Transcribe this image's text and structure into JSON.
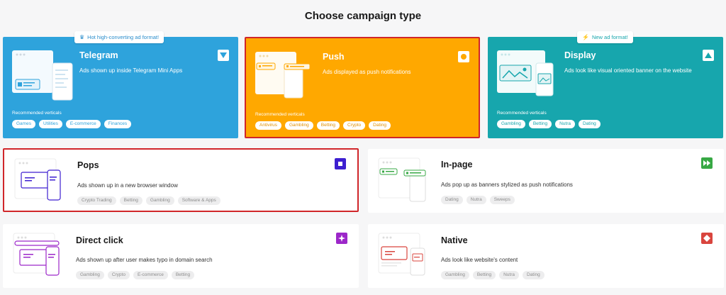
{
  "page": {
    "title": "Choose campaign type"
  },
  "colors": {
    "telegram": "#2ea3dc",
    "push": "#ffa800",
    "display": "#17a6ad",
    "selected_border": "#d0262a",
    "pops": "#3d1fd0",
    "inpage": "#37a844",
    "directclick": "#9c27c9",
    "native": "#d9453e"
  },
  "cards": {
    "telegram": {
      "name": "Telegram",
      "desc": "Ads shown up inside Telegram Mini Apps",
      "badge": "Hot high-converting ad format!",
      "badge_icon": "crown-icon",
      "rec_label": "Recommended verticals",
      "tags": [
        "Games",
        "Utilities",
        "E-commerce",
        "Finances"
      ],
      "icon": "triangle-down-icon"
    },
    "push": {
      "name": "Push",
      "desc": "Ads displayed as push notifications",
      "rec_label": "Recommended verticals",
      "tags": [
        "Antivirus",
        "Gambling",
        "Betting",
        "Crypto",
        "Dating"
      ],
      "icon": "circle-icon",
      "selected": true
    },
    "display": {
      "name": "Display",
      "desc": "Ads look like visual oriented banner on the website",
      "badge": "New ad format!",
      "badge_icon": "lightning-icon",
      "rec_label": "Recommended verticals",
      "tags": [
        "Gambling",
        "Betting",
        "Nutra",
        "Dating"
      ],
      "icon": "triangle-up-icon"
    },
    "pops": {
      "name": "Pops",
      "desc": "Ads shown up in a new browser window",
      "tags": [
        "Crypto Trading",
        "Betting",
        "Gambling",
        "Software & Apps"
      ],
      "icon": "square-icon",
      "selected": true
    },
    "inpage": {
      "name": "In-page",
      "desc": "Ads pop up as banners stylized as push notifications",
      "tags": [
        "Dating",
        "Nutra",
        "Sweeps"
      ],
      "icon": "fast-forward-icon"
    },
    "directclick": {
      "name": "Direct click",
      "desc": "Ads shown up after user makes typo in domain search",
      "tags": [
        "Gambling",
        "Crypto",
        "E-commerce",
        "Betting"
      ],
      "icon": "sparkle-icon"
    },
    "native": {
      "name": "Native",
      "desc": "Ads look like website's content",
      "tags": [
        "Gambling",
        "Betting",
        "Nutra",
        "Dating"
      ],
      "icon": "diamond-icon"
    }
  }
}
